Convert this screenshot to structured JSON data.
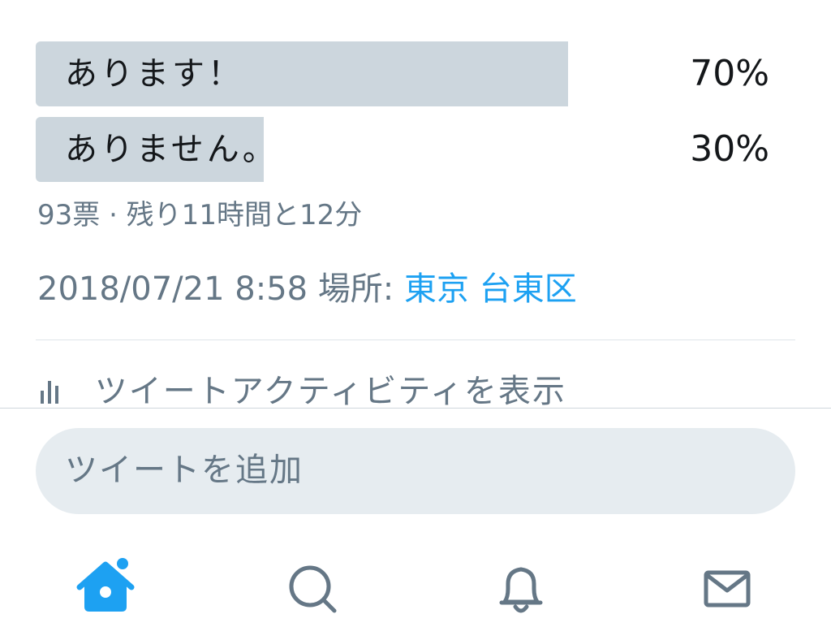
{
  "poll": {
    "options": [
      {
        "label": "あります！",
        "percent": "70%",
        "value": 0.7
      },
      {
        "label": "ありません。",
        "percent": "30%",
        "value": 0.3
      }
    ],
    "meta": "93票 · 残り11時間と12分"
  },
  "tweet_meta": {
    "datetime": "2018/07/21 8:58",
    "location_label": "場所:",
    "location": "東京 台東区"
  },
  "activity": {
    "label": "ツイートアクティビティを表示",
    "icon": "bar-chart-icon"
  },
  "reply": {
    "placeholder": "ツイートを追加"
  },
  "tabbar": {
    "items": [
      {
        "name": "home",
        "icon": "home-icon",
        "active": true,
        "badge": true
      },
      {
        "name": "search",
        "icon": "search-icon",
        "active": false
      },
      {
        "name": "notifications",
        "icon": "bell-icon",
        "active": false
      },
      {
        "name": "messages",
        "icon": "envelope-icon",
        "active": false
      }
    ]
  },
  "colors": {
    "accent": "#1da1f2",
    "poll_bar": "#ccd6dd",
    "muted_text": "#657786",
    "reply_bg": "#e6ecf0"
  }
}
